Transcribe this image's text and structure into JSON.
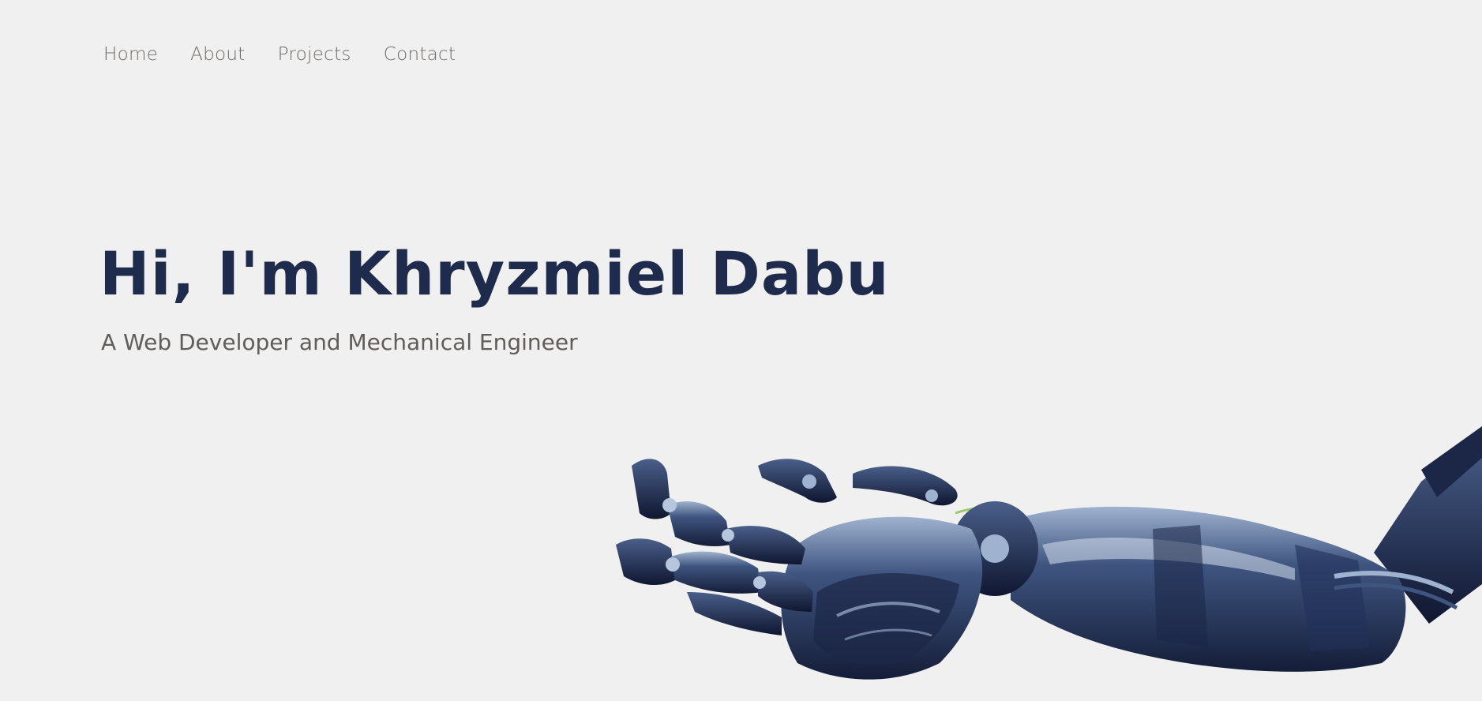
{
  "nav": {
    "items": [
      {
        "label": "Home"
      },
      {
        "label": "About"
      },
      {
        "label": "Projects"
      },
      {
        "label": "Contact"
      }
    ]
  },
  "hero": {
    "title": "Hi, I'm Khryzmiel Dabu",
    "subtitle": "A Web Developer and Mechanical Engineer"
  },
  "illustration": {
    "icon": "robotic-arm-icon"
  },
  "colors": {
    "background": "#f0f0f0",
    "title": "#1f2b4d",
    "subtitle": "#5f5c59",
    "nav": "#6d6a67",
    "robot_dark": "#1c2747",
    "robot_mid": "#3f5580",
    "robot_light": "#9fb2cf"
  }
}
